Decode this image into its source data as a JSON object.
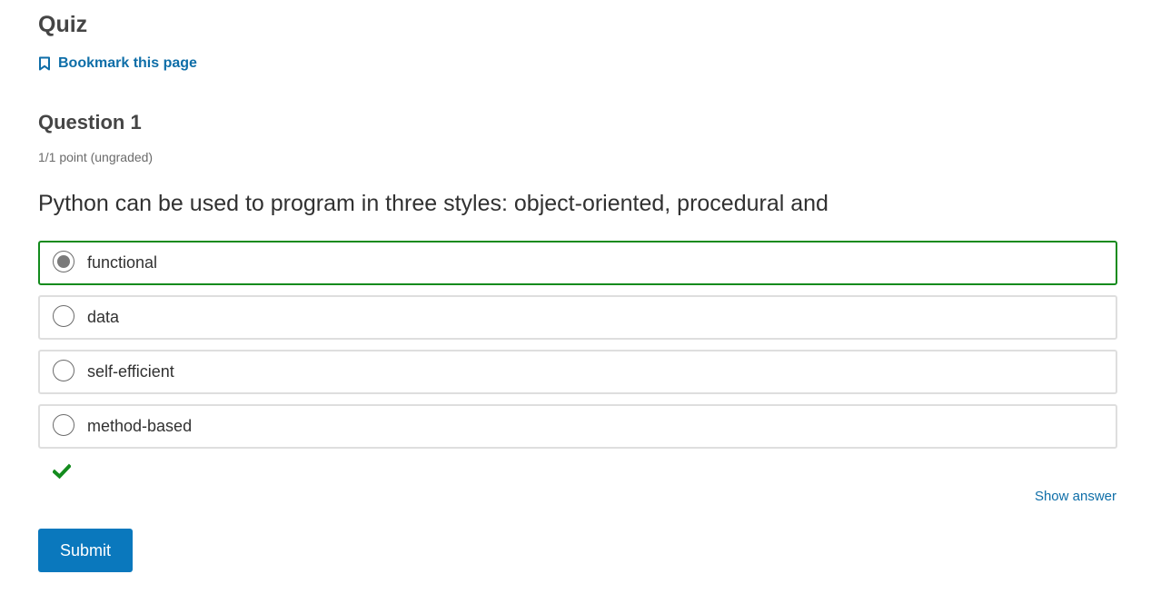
{
  "quiz": {
    "title": "Quiz",
    "bookmark_label": "Bookmark this page",
    "bookmark_icon": "bookmark-icon"
  },
  "question": {
    "title": "Question 1",
    "points": "1/1 point (ungraded)",
    "prompt": "Python can be used to program in three styles: object-oriented, procedural and",
    "choices": [
      {
        "label": "functional",
        "selected": true,
        "correct": true
      },
      {
        "label": "data",
        "selected": false
      },
      {
        "label": "self-efficient",
        "selected": false
      },
      {
        "label": "method-based",
        "selected": false
      }
    ],
    "status_icon": "checkmark-icon",
    "show_answer_label": "Show answer"
  },
  "actions": {
    "submit_label": "Submit"
  },
  "colors": {
    "accent_blue": "#0e6ea8",
    "button_blue": "#0a78bd",
    "correct_green": "#138b1d",
    "border_gray": "#dedede"
  }
}
